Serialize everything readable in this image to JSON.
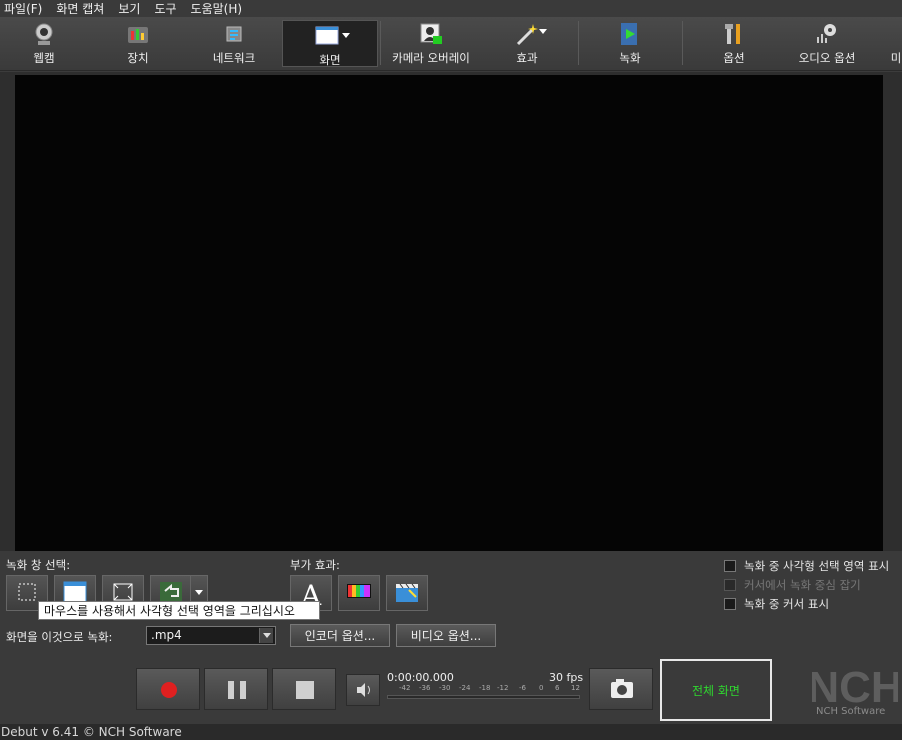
{
  "menu": [
    "파일(F)",
    "화면 캡쳐",
    "보기",
    "도구",
    "도움말(H)"
  ],
  "toolbar": {
    "webcam": "웹캠",
    "device": "장치",
    "network": "네트워크",
    "screen": "화면",
    "camera_overlay": "카메라 오버레이",
    "effects": "효과",
    "record": "녹화",
    "options": "옵션",
    "audio_options": "오디오 옵션",
    "more": "미"
  },
  "capture": {
    "window_select_label": "녹화 창 선택:",
    "extra_effects_label": "부가 효과:",
    "tooltip": "마우스를 사용해서 사각형 선택 영역을 그리십시오"
  },
  "checkboxes": [
    {
      "label": "녹화 중 사각형 선택 영역 표시",
      "enabled": true
    },
    {
      "label": "커서에서 녹화 중심 잡기",
      "enabled": false
    },
    {
      "label": "녹화 중 커서 표시",
      "enabled": true
    }
  ],
  "output": {
    "label": "화면을 이것으로 녹화:",
    "format": ".mp4",
    "encoder_options": "인코더 옵션...",
    "video_options": "비디오 옵션..."
  },
  "recording": {
    "time": "0:00:00.000",
    "fps": "30 fps",
    "meter_ticks": [
      "-42",
      "-36",
      "-30",
      "-24",
      "-18",
      "-12",
      "-6",
      "0",
      "6",
      "12"
    ]
  },
  "fullscreen_button": "전체 화면",
  "logo": {
    "mark": "NCH",
    "name": "NCH Software"
  },
  "status": "Debut v 6.41 © NCH Software",
  "colors": {
    "record": "#e02020",
    "fullscreen_text": "#2fd62f",
    "preview_bg": "#050505"
  }
}
